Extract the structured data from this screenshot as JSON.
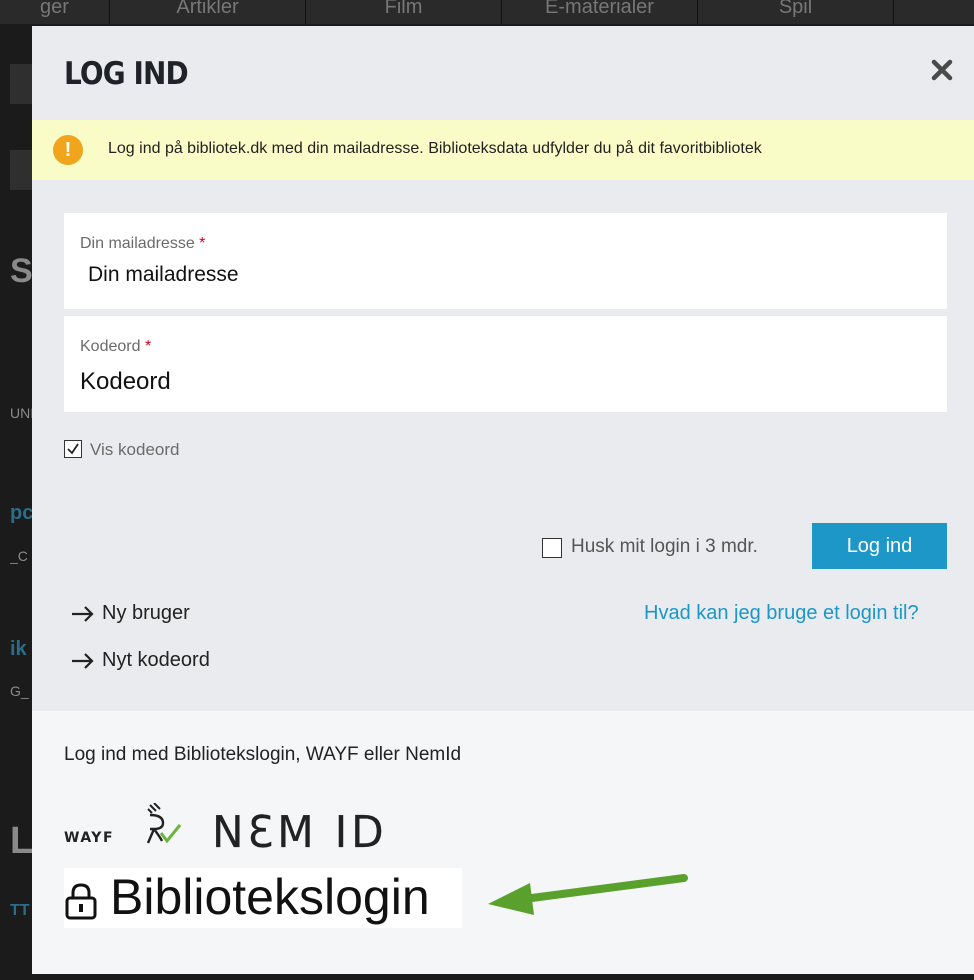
{
  "background": {
    "nav_tabs": [
      "ger",
      "Artikler",
      "Film",
      "E-materialer",
      "Spil"
    ],
    "side_fragments": [
      "SU",
      "UNI",
      "pc",
      "_C",
      "ik",
      "G_",
      "L",
      "TT"
    ]
  },
  "modal": {
    "title": "LOG IND",
    "close_icon": "close-icon",
    "notice": {
      "icon": "exclamation-icon",
      "text": "Log ind på bibliotek.dk med din mailadresse. Biblioteksdata udfylder du på dit favoritbibliotek"
    },
    "email": {
      "label": "Din mailadresse",
      "required_mark": "*",
      "placeholder": "Din mailadresse"
    },
    "password": {
      "label": "Kodeord",
      "required_mark": "*",
      "placeholder": "Kodeord"
    },
    "show_password": {
      "label": "Vis kodeord",
      "checked": true
    },
    "remember": {
      "label": "Husk mit login i 3 mdr.",
      "checked": false
    },
    "login_button": "Log ind",
    "new_user_link": "Ny bruger",
    "new_password_link": "Nyt kodeord",
    "help_link": "Hvad kan jeg bruge et login til?",
    "alt_login": {
      "title": "Log ind med Bibliotekslogin, WAYF eller NemId",
      "wayf_text": "WAYF",
      "nemid_text": "NƐM ID",
      "biblio_text": "Bibliotekslogin"
    }
  },
  "colors": {
    "accent": "#1d97c7",
    "notice_bg": "#fafcc8",
    "notice_icon": "#f0a51c",
    "required": "#d0021b",
    "annotation_arrow": "#5aa02c"
  }
}
